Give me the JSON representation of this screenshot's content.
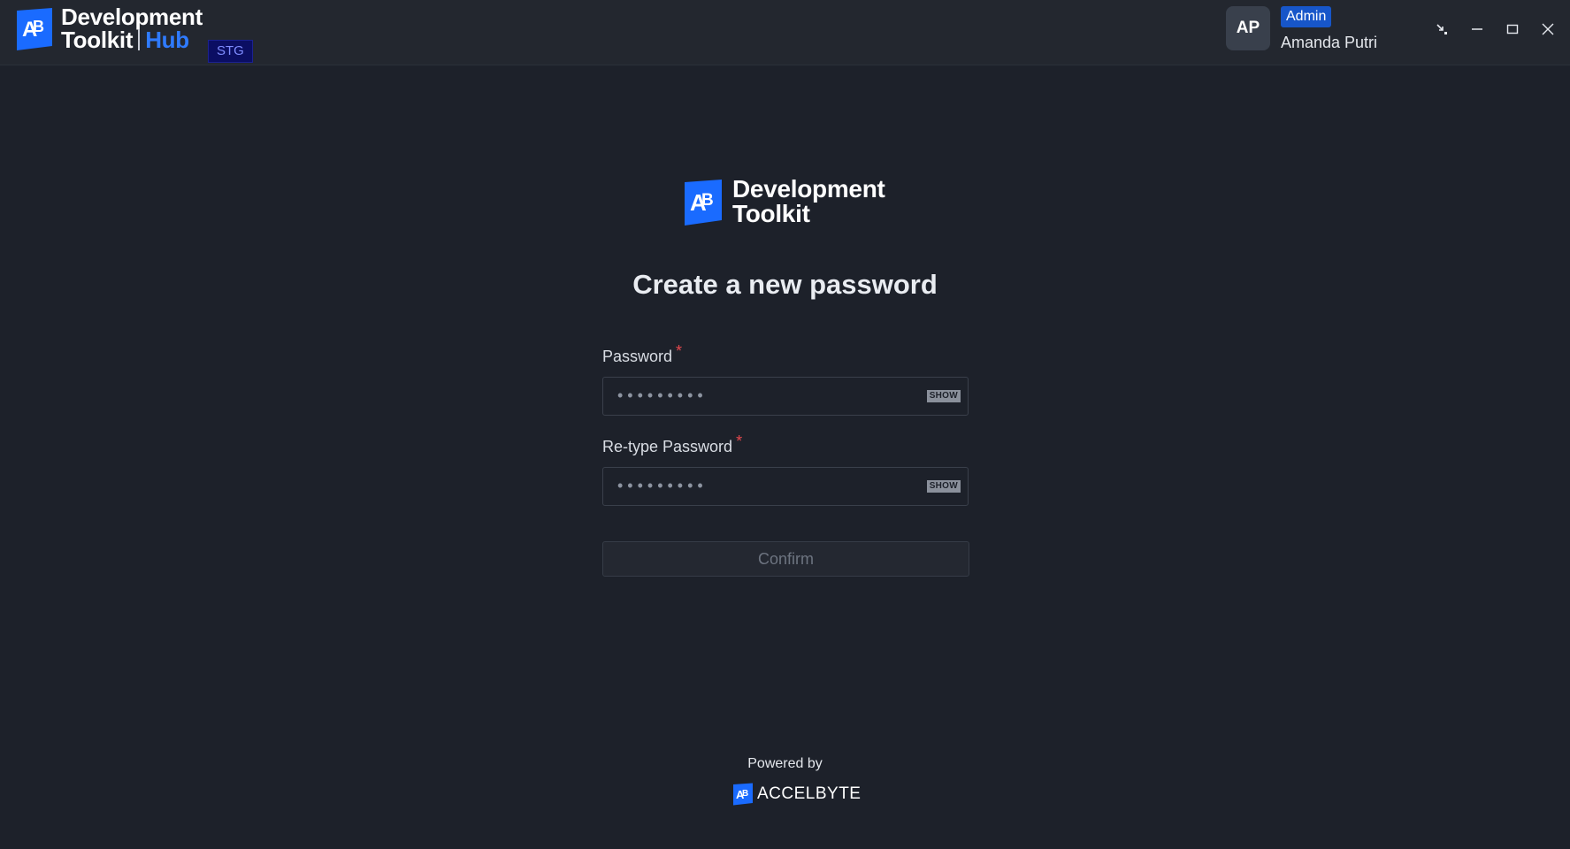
{
  "app": {
    "brand_line1": "Development",
    "brand_line2": "Toolkit",
    "brand_hub": "Hub",
    "env_badge": "STG"
  },
  "user": {
    "initials": "AP",
    "role": "Admin",
    "name": "Amanda Putri"
  },
  "window_controls": {
    "icons": [
      "collapse-icon",
      "minimize-icon",
      "maximize-icon",
      "close-icon"
    ]
  },
  "form": {
    "logo_line1": "Development",
    "logo_line2": "Toolkit",
    "title": "Create a new password",
    "password_label": "Password",
    "password_required": "*",
    "password_value": "•••••••••",
    "password_show": "SHOW",
    "retype_label": "Re-type Password",
    "retype_required": "*",
    "retype_value": "•••••••••",
    "retype_show": "SHOW",
    "confirm_label": "Confirm"
  },
  "footer": {
    "powered_by": "Powered by",
    "company": "ACCELBYTE"
  },
  "colors": {
    "background": "#1d212a",
    "topbar": "#23272f",
    "accent_blue": "#2f7bff",
    "required_red": "#e5484d"
  }
}
